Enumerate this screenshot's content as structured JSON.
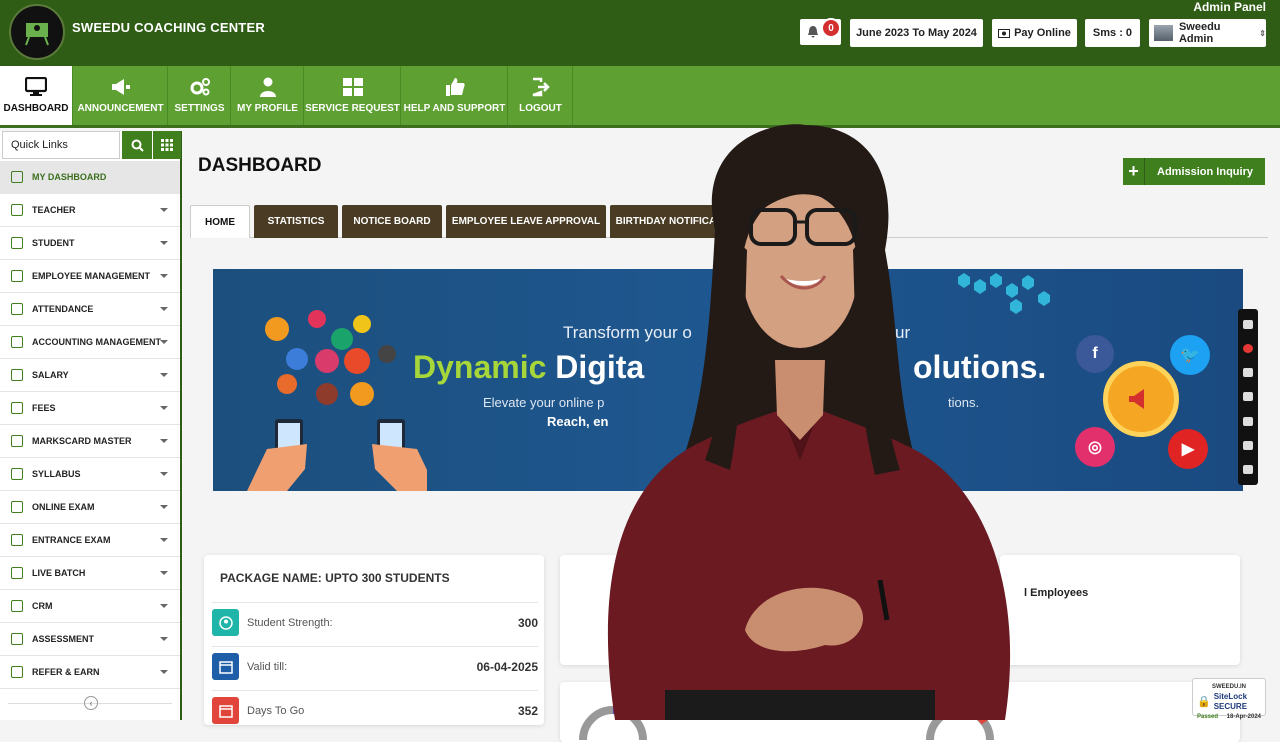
{
  "header": {
    "brand": "SWEEDU COACHING CENTER",
    "admin_panel": "Admin Panel",
    "notification_count": "0",
    "session": "June 2023 To May 2024",
    "pay_online": "Pay Online",
    "sms": "Sms : 0",
    "user": "Sweedu Admin"
  },
  "nav": [
    {
      "label": "DASHBOARD",
      "icon": "monitor-icon"
    },
    {
      "label": "ANNOUNCEMENT",
      "icon": "megaphone-icon"
    },
    {
      "label": "SETTINGS",
      "icon": "gears-icon"
    },
    {
      "label": "MY PROFILE",
      "icon": "user-icon"
    },
    {
      "label": "SERVICE REQUEST",
      "icon": "grid-icon"
    },
    {
      "label": "HELP AND SUPPORT",
      "icon": "thumbs-up-icon"
    },
    {
      "label": "LOGOUT",
      "icon": "logout-icon"
    }
  ],
  "sidebar": {
    "quick_links": "Quick Links",
    "items": [
      "MY DASHBOARD",
      "TEACHER",
      "STUDENT",
      "EMPLOYEE MANAGEMENT",
      "ATTENDANCE",
      "ACCOUNTING MANAGEMENT",
      "SALARY",
      "FEES",
      "MARKSCARD MASTER",
      "SYLLABUS",
      "ONLINE EXAM",
      "ENTRANCE EXAM",
      "LIVE BATCH",
      "CRM",
      "ASSESSMENT",
      "REFER & EARN"
    ]
  },
  "main": {
    "title": "DASHBOARD",
    "admission_button": "Admission Inquiry",
    "tabs": [
      "HOME",
      "STATISTICS",
      "NOTICE BOARD",
      "EMPLOYEE LEAVE APPROVAL",
      "BIRTHDAY NOTIFICATI"
    ]
  },
  "banner": {
    "line1": "Transform your o",
    "line1_tail": "ur",
    "dynamic": "Dynamic",
    "digital": "Digita",
    "solutions": "olutions.",
    "line3": "Elevate your online p",
    "line3_tail": "tions.",
    "line4": "Reach, en"
  },
  "package": {
    "title": "PACKAGE NAME: UPTO 300 STUDENTS",
    "rows": [
      {
        "label": "Student Strength:",
        "value": "300",
        "color": "#1fb5a8"
      },
      {
        "label": "Valid till:",
        "value": "06-04-2025",
        "color": "#1e5ea8"
      },
      {
        "label": "Days To Go",
        "value": "352",
        "color": "#e0443a"
      }
    ]
  },
  "employees_card": {
    "label": "l Employees"
  },
  "sitelock": {
    "top": "SWEEDU.IN",
    "name": "SiteLock",
    "secure": "SECURE",
    "passed": "Passed",
    "date": "18-Apr-2024"
  },
  "colors": {
    "header": "#2f5d16",
    "nav": "#5ea032",
    "tab": "#4a3c24",
    "accent": "#3f7f1e"
  }
}
